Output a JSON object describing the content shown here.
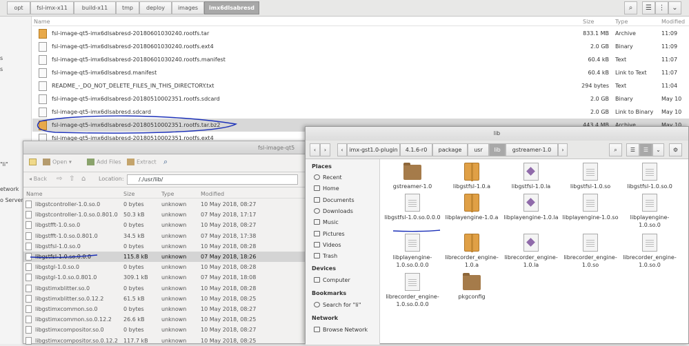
{
  "bg_window": {
    "breadcrumbs": [
      "opt",
      "fsl-imx-x11",
      "build-x11",
      "tmp",
      "deploy",
      "images",
      "imx6dlsabresd"
    ],
    "columns": {
      "name": "Name",
      "size": "Size",
      "type": "Type",
      "modified": "Modified"
    },
    "sidebar_fragments": [
      "s",
      "s",
      "\"li\"",
      "etwork",
      "o Server"
    ],
    "files": [
      {
        "name": "fsl-image-qt5-imx6dlsabresd-20180601030240.rootfs.tar",
        "size": "833.1 MB",
        "type": "Archive",
        "modified": "11:09",
        "icon": "archive"
      },
      {
        "name": "fsl-image-qt5-imx6dlsabresd-20180601030240.rootfs.ext4",
        "size": "2.0 GB",
        "type": "Binary",
        "modified": "11:09",
        "icon": "file"
      },
      {
        "name": "fsl-image-qt5-imx6dlsabresd-20180601030240.rootfs.manifest",
        "size": "60.4 kB",
        "type": "Text",
        "modified": "11:07",
        "icon": "file"
      },
      {
        "name": "fsl-image-qt5-imx6dlsabresd.manifest",
        "size": "60.4 kB",
        "type": "Link to Text",
        "modified": "11:07",
        "icon": "file"
      },
      {
        "name": "README_-_DO_NOT_DELETE_FILES_IN_THIS_DIRECTORY.txt",
        "size": "294 bytes",
        "type": "Text",
        "modified": "11:04",
        "icon": "file"
      },
      {
        "name": "fsl-image-qt5-imx6dlsabresd-20180510002351.rootfs.sdcard",
        "size": "2.0 GB",
        "type": "Binary",
        "modified": "May 10",
        "icon": "file"
      },
      {
        "name": "fsl-image-qt5-imx6dlsabresd.sdcard",
        "size": "2.0 GB",
        "type": "Link to Binary",
        "modified": "May 10",
        "icon": "file"
      },
      {
        "name": "fsl-image-qt5-imx6dlsabresd-20180510002351.rootfs.tar.bz2",
        "size": "443.4 MB",
        "type": "Archive",
        "modified": "May 10",
        "icon": "archive"
      },
      {
        "name": "fsl-image-qt5-imx6dlsabresd-20180510002351.rootfs.ext4",
        "size": "",
        "type": "",
        "modified": "",
        "icon": "file"
      }
    ]
  },
  "archive_window": {
    "title": "fsl-image-qt5",
    "toolbar": {
      "open": "Open",
      "add_files": "Add Files",
      "extract": "Extract"
    },
    "nav": {
      "back": "Back",
      "location_label": "Location:",
      "location": "/./usr/lib/"
    },
    "columns": {
      "name": "Name",
      "size": "Size",
      "type": "Type",
      "modified": "Modified"
    },
    "rows": [
      {
        "name": "libgstcontroller-1.0.so.0",
        "size": "0 bytes",
        "type": "unknown",
        "modified": "10 May 2018, 08:27"
      },
      {
        "name": "libgstcontroller-1.0.so.0.801.0",
        "size": "50.3 kB",
        "type": "unknown",
        "modified": "07 May 2018, 17:17"
      },
      {
        "name": "libgstfft-1.0.so.0",
        "size": "0 bytes",
        "type": "unknown",
        "modified": "10 May 2018, 08:27"
      },
      {
        "name": "libgstfft-1.0.so.0.801.0",
        "size": "34.5 kB",
        "type": "unknown",
        "modified": "07 May 2018, 17:38"
      },
      {
        "name": "libgstfsl-1.0.so.0",
        "size": "0 bytes",
        "type": "unknown",
        "modified": "10 May 2018, 08:28"
      },
      {
        "name": "libgstfsl-1.0.so.0.0.0",
        "size": "115.8 kB",
        "type": "unknown",
        "modified": "07 May 2018, 18:26"
      },
      {
        "name": "libgstgl-1.0.so.0",
        "size": "0 bytes",
        "type": "unknown",
        "modified": "10 May 2018, 08:28"
      },
      {
        "name": "libgstgl-1.0.so.0.801.0",
        "size": "309.1 kB",
        "type": "unknown",
        "modified": "07 May 2018, 18:08"
      },
      {
        "name": "libgstimxblitter.so.0",
        "size": "0 bytes",
        "type": "unknown",
        "modified": "10 May 2018, 08:28"
      },
      {
        "name": "libgstimxblitter.so.0.12.2",
        "size": "61.5 kB",
        "type": "unknown",
        "modified": "10 May 2018, 08:25"
      },
      {
        "name": "libgstimxcommon.so.0",
        "size": "0 bytes",
        "type": "unknown",
        "modified": "10 May 2018, 08:27"
      },
      {
        "name": "libgstimxcommon.so.0.12.2",
        "size": "26.6 kB",
        "type": "unknown",
        "modified": "10 May 2018, 08:25"
      },
      {
        "name": "libgstimxcompositor.so.0",
        "size": "0 bytes",
        "type": "unknown",
        "modified": "10 May 2018, 08:27"
      },
      {
        "name": "libgstimxcompositor.so.0.12.2",
        "size": "117.7 kB",
        "type": "unknown",
        "modified": "10 May 2018, 08:25"
      }
    ]
  },
  "lib_window": {
    "title": "lib",
    "path": [
      "imx-gst1.0-plugin",
      "4.1.6-r0",
      "package",
      "usr",
      "lib",
      "gstreamer-1.0"
    ],
    "places_header": "Places",
    "places": [
      "Recent",
      "Home",
      "Documents",
      "Downloads",
      "Music",
      "Pictures",
      "Videos",
      "Trash"
    ],
    "devices_header": "Devices",
    "devices": [
      "Computer"
    ],
    "bookmarks_header": "Bookmarks",
    "bookmarks": [
      "Search for \"li\""
    ],
    "network_header": "Network",
    "network": [
      "Browse Network"
    ],
    "items": [
      {
        "label": "gstreamer-1.0",
        "icon": "folder"
      },
      {
        "label": "libgstfsl-1.0.a",
        "icon": "pkg"
      },
      {
        "label": "libgstfsl-1.0.la",
        "icon": "la"
      },
      {
        "label": "libgstfsl-1.0.so",
        "icon": "doc"
      },
      {
        "label": "libgstfsl-1.0.so.0",
        "icon": "doc"
      },
      {
        "label": "libgstfsl-1.0.so.0.0.0",
        "icon": "doc"
      },
      {
        "label": "libplayengine-1.0.a",
        "icon": "pkg"
      },
      {
        "label": "libplayengine-1.0.la",
        "icon": "la"
      },
      {
        "label": "libplayengine-1.0.so",
        "icon": "doc"
      },
      {
        "label": "libplayengine-1.0.so.0",
        "icon": "doc"
      },
      {
        "label": "libplayengine-1.0.so.0.0.0",
        "icon": "doc"
      },
      {
        "label": "librecorder_engine-1.0.a",
        "icon": "pkg"
      },
      {
        "label": "librecorder_engine-1.0.la",
        "icon": "la"
      },
      {
        "label": "librecorder_engine-1.0.so",
        "icon": "doc"
      },
      {
        "label": "librecorder_engine-1.0.so.0",
        "icon": "doc"
      },
      {
        "label": "librecorder_engine-1.0.so.0.0.0",
        "icon": "doc"
      },
      {
        "label": "pkgconfig",
        "icon": "folder"
      }
    ]
  },
  "colors": {
    "annotation": "#1a2fb8",
    "archive_icon": "#e0a046",
    "folder": "#a57b4a"
  }
}
